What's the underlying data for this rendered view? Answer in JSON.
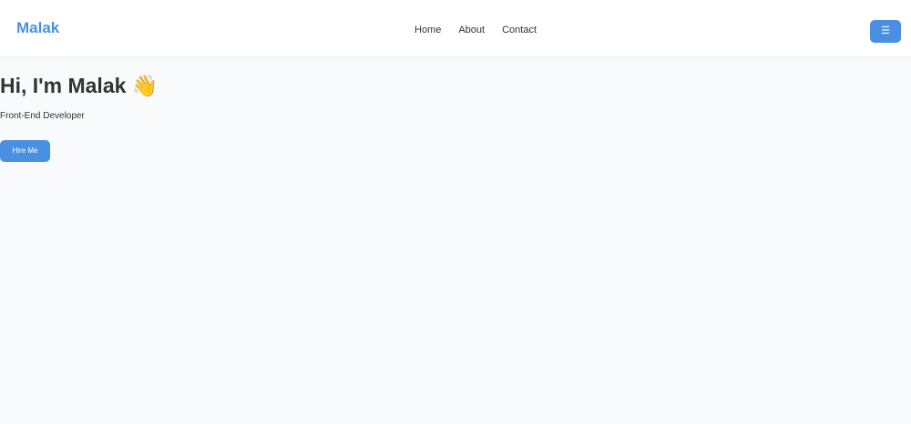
{
  "navbar": {
    "logo": "Malak",
    "links": [
      {
        "label": "Home"
      },
      {
        "label": "About"
      },
      {
        "label": "Contact"
      }
    ],
    "menu_button_label": "☰"
  },
  "hero": {
    "title": "Hi, I'm Malak 👋",
    "subtitle": "Front-End Developer",
    "cta_label": "Hire Me"
  },
  "colors": {
    "accent": "#4a90e2",
    "background": "#f8fafc",
    "navbar_background": "#ffffff",
    "text": "#333333"
  },
  "icons": {
    "menu_button": "hamburger-icon",
    "hero_emoji": "waving-hand-icon"
  }
}
